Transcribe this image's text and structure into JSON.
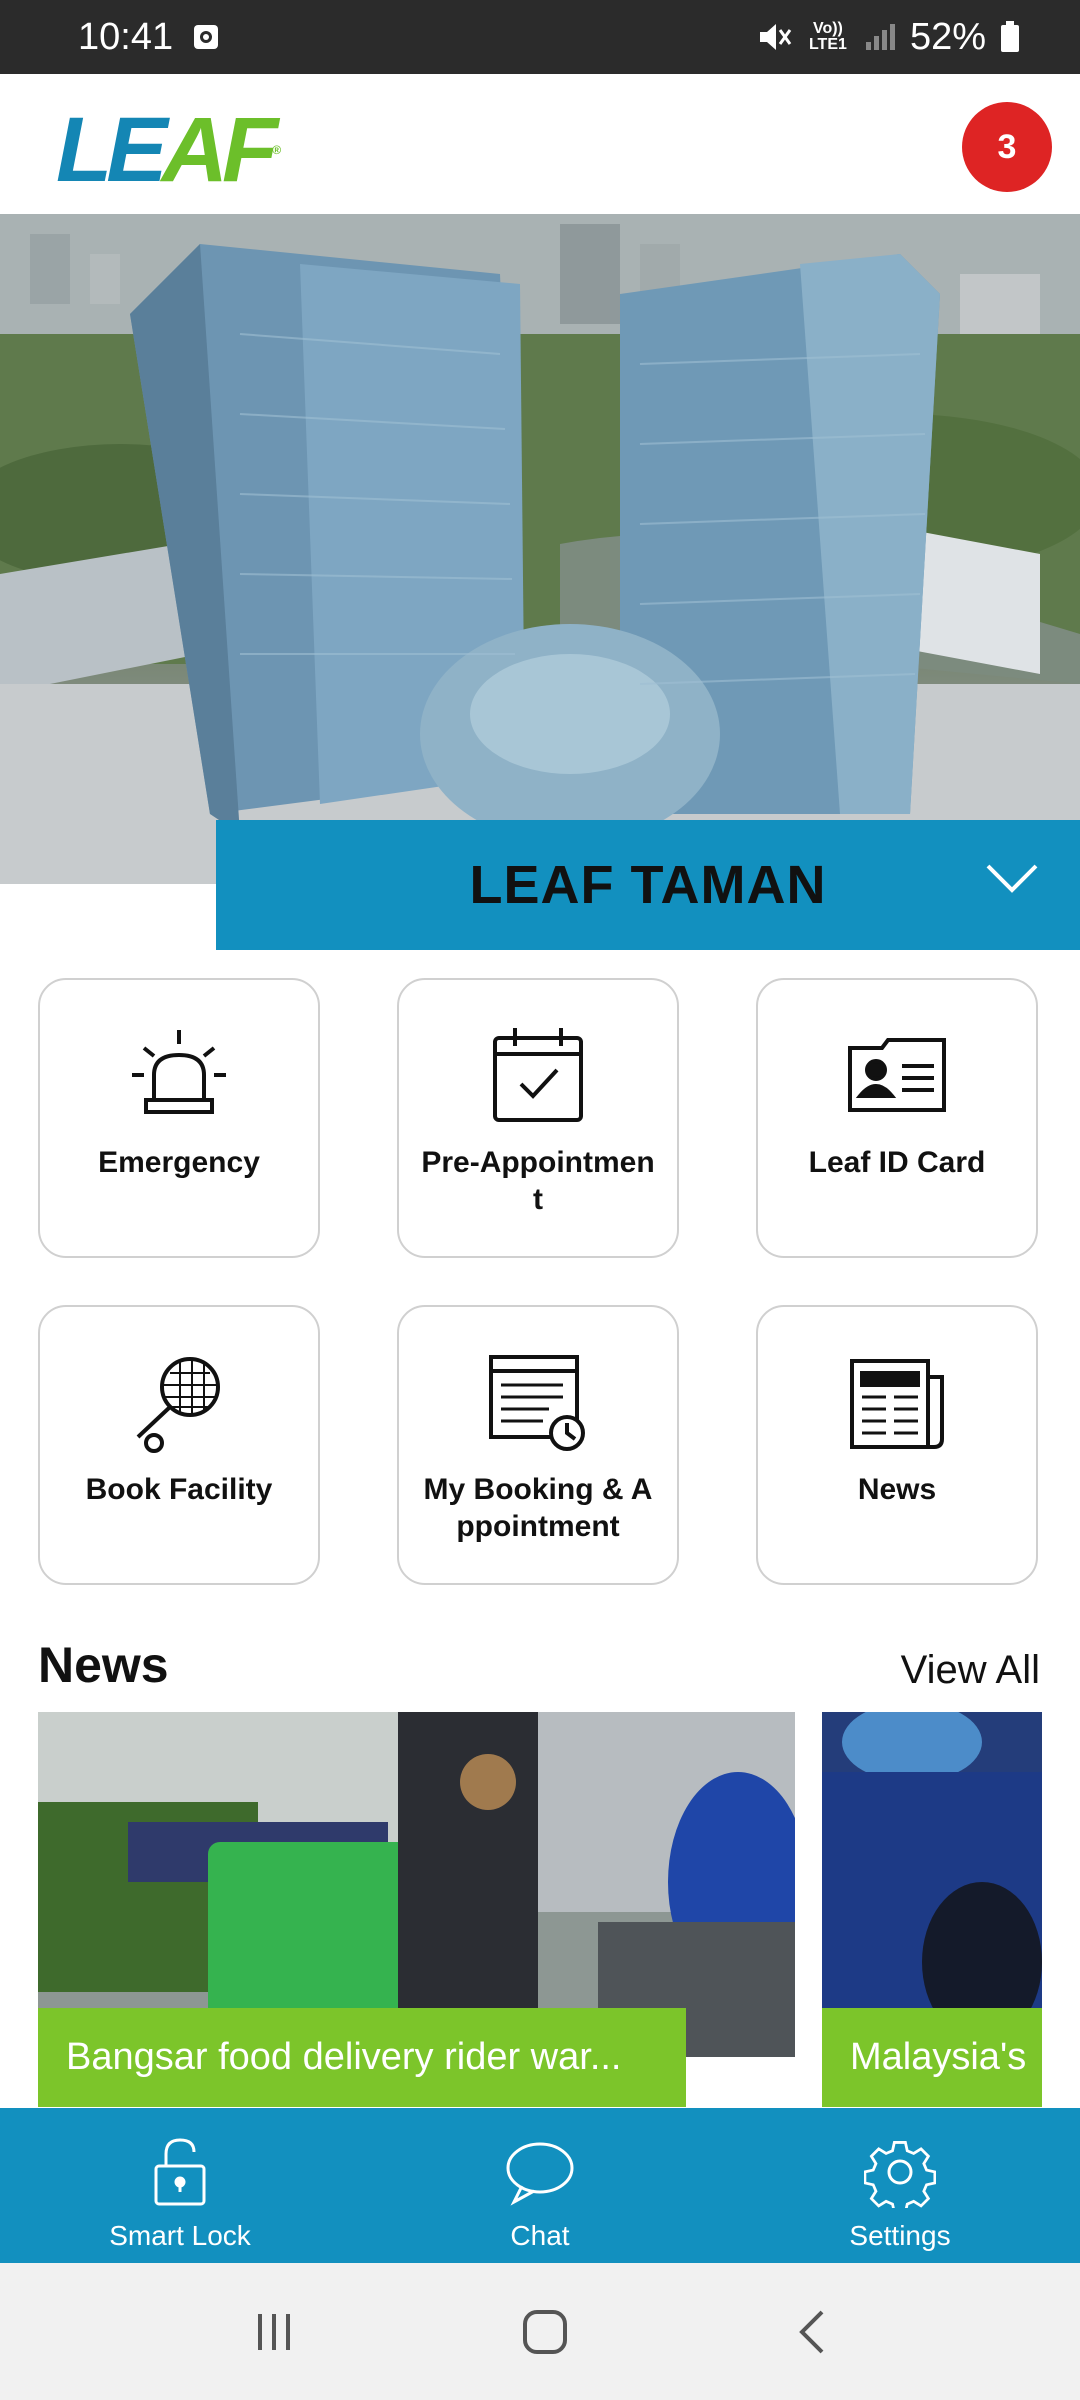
{
  "status_bar": {
    "time": "10:41",
    "network": "Vo)) LTE1",
    "battery": "52%"
  },
  "header": {
    "logo_part1": "LE",
    "logo_part2": "AF",
    "logo_mark": "®",
    "notification_count": "3"
  },
  "property": {
    "name": "LEAF TAMAN"
  },
  "menu": [
    {
      "label": "Emergency",
      "icon": "siren-icon"
    },
    {
      "label": "Pre-Appointment",
      "icon": "calendar-check-icon"
    },
    {
      "label": "Leaf ID Card",
      "icon": "id-card-icon"
    },
    {
      "label": "Book Facility",
      "icon": "racket-icon"
    },
    {
      "label": "My Booking & Appointment",
      "icon": "schedule-icon"
    },
    {
      "label": "News",
      "icon": "newspaper-icon"
    }
  ],
  "news": {
    "title": "News",
    "view_all": "View All",
    "items": [
      {
        "caption": "Bangsar food delivery rider war..."
      },
      {
        "caption": "Malaysia's"
      }
    ]
  },
  "bottom_nav": [
    {
      "label": "Smart Lock",
      "icon": "lock-icon"
    },
    {
      "label": "Chat",
      "icon": "chat-icon"
    },
    {
      "label": "Settings",
      "icon": "gear-icon"
    }
  ],
  "colors": {
    "brand_blue": "#1290bf",
    "brand_green": "#7cc52a",
    "badge_red": "#de2424"
  }
}
